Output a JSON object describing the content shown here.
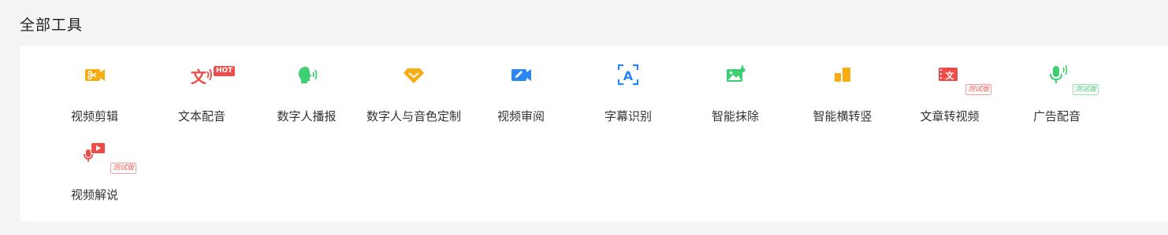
{
  "page": {
    "title": "全部工具"
  },
  "tools": [
    {
      "label": "视频剪辑",
      "icon": "video-scissors-icon",
      "color": "#f9ab12"
    },
    {
      "label": "文本配音",
      "icon": "text-voice-icon",
      "color": "#ee4c48",
      "badge": "HOT"
    },
    {
      "label": "数字人播报",
      "icon": "digital-human-broadcast-icon",
      "color": "#3fcf73"
    },
    {
      "label": "数字人与音色定制",
      "icon": "diamond-customize-icon",
      "color": "#f9ab12"
    },
    {
      "label": "视频审阅",
      "icon": "video-review-icon",
      "color": "#2a86f5"
    },
    {
      "label": "字幕识别",
      "icon": "subtitle-recognition-icon",
      "color": "#2a86f5"
    },
    {
      "label": "智能抹除",
      "icon": "smart-erase-icon",
      "color": "#3fcf73"
    },
    {
      "label": "智能横转竖",
      "icon": "landscape-to-portrait-icon",
      "color": "#f9ab12"
    },
    {
      "label": "文章转视频",
      "icon": "article-to-video-icon",
      "color": "#ee4c48",
      "badge": "测试版"
    },
    {
      "label": "广告配音",
      "icon": "ad-voice-mic-icon",
      "color": "#3fcf73",
      "badge": "测试版"
    },
    {
      "label": "视频解说",
      "icon": "video-narration-icon",
      "color": "#ee4c48",
      "badge": "测试版"
    }
  ]
}
